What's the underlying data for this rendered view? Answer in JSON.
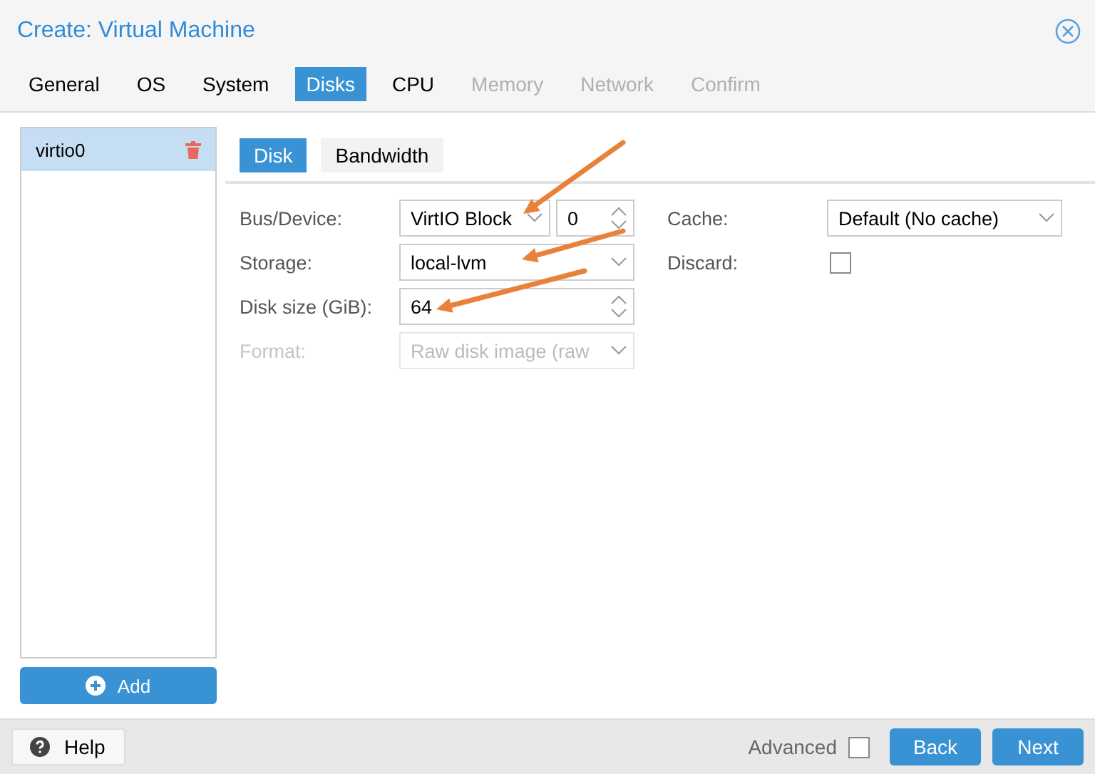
{
  "window": {
    "title": "Create: Virtual Machine"
  },
  "tabs": [
    {
      "label": "General",
      "selected": false,
      "disabled": false
    },
    {
      "label": "OS",
      "selected": false,
      "disabled": false
    },
    {
      "label": "System",
      "selected": false,
      "disabled": false
    },
    {
      "label": "Disks",
      "selected": true,
      "disabled": false
    },
    {
      "label": "CPU",
      "selected": false,
      "disabled": false
    },
    {
      "label": "Memory",
      "selected": false,
      "disabled": true
    },
    {
      "label": "Network",
      "selected": false,
      "disabled": true
    },
    {
      "label": "Confirm",
      "selected": false,
      "disabled": true
    }
  ],
  "disk_list": {
    "items": [
      {
        "label": "virtio0",
        "selected": true
      }
    ],
    "add_button": "Add"
  },
  "subtabs": [
    {
      "label": "Disk",
      "selected": true
    },
    {
      "label": "Bandwidth",
      "selected": false
    }
  ],
  "form_left": [
    {
      "label": "Bus/Device:",
      "kind": "bus",
      "value": "VirtIO Block",
      "number": "0",
      "disabled": false
    },
    {
      "label": "Storage:",
      "kind": "select",
      "value": "local-lvm",
      "disabled": false
    },
    {
      "label": "Disk size (GiB):",
      "kind": "spinner",
      "value": "64",
      "disabled": false
    },
    {
      "label": "Format:",
      "kind": "select",
      "value": "Raw disk image (raw",
      "disabled": true
    }
  ],
  "form_right": [
    {
      "label": "Cache:",
      "kind": "select",
      "value": "Default (No cache)"
    },
    {
      "label": "Discard:",
      "kind": "checkbox",
      "checked": false
    }
  ],
  "footer": {
    "help": "Help",
    "advanced": {
      "label": "Advanced",
      "checked": false
    },
    "back": "Back",
    "next": "Next"
  }
}
